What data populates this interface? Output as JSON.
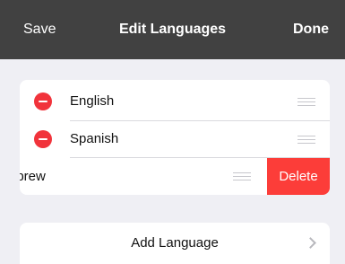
{
  "navbar": {
    "left_label": "Save",
    "title": "Edit Languages",
    "right_label": "Done"
  },
  "languages": [
    {
      "label": "English"
    },
    {
      "label": "Spanish"
    },
    {
      "label": "ebrew"
    }
  ],
  "swipe_action": {
    "delete_label": "Delete"
  },
  "add_language": {
    "label": "Add Language"
  },
  "icons": {
    "remove": "minus-circle-icon",
    "reorder": "drag-handle-icon",
    "chevron": "chevron-right-icon"
  },
  "colors": {
    "navbar_bg": "#414141",
    "destructive": "#f1333b",
    "delete_bg": "#fc3d39",
    "page_bg": "#efeff4"
  }
}
